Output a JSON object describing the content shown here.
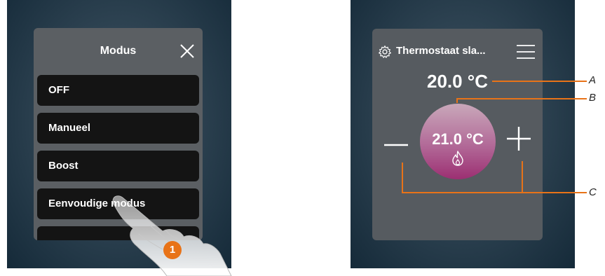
{
  "left_screen": {
    "dialog": {
      "title": "Modus",
      "close_icon": "close-icon",
      "items": [
        {
          "label": "OFF"
        },
        {
          "label": "Manueel"
        },
        {
          "label": "Boost"
        },
        {
          "label": "Eenvoudige modus"
        },
        {
          "label": ""
        }
      ]
    },
    "step_badge": "1"
  },
  "right_screen": {
    "card": {
      "settings_icon": "gear-icon",
      "title": "Thermostaat sla...",
      "menu_icon": "menu-icon",
      "set_temperature": "20.0 °C",
      "measured_temperature": "21.0 °C",
      "heating_icon": "flame-icon",
      "minus_icon": "minus-icon",
      "plus_icon": "plus-icon"
    },
    "callouts": {
      "a": "A",
      "b": "B",
      "c": "C"
    }
  },
  "colors": {
    "accent": "#e87318",
    "dial_bottom": "#9c2f72",
    "dial_top": "#c9a8ba",
    "panel": "#5b5f63"
  }
}
